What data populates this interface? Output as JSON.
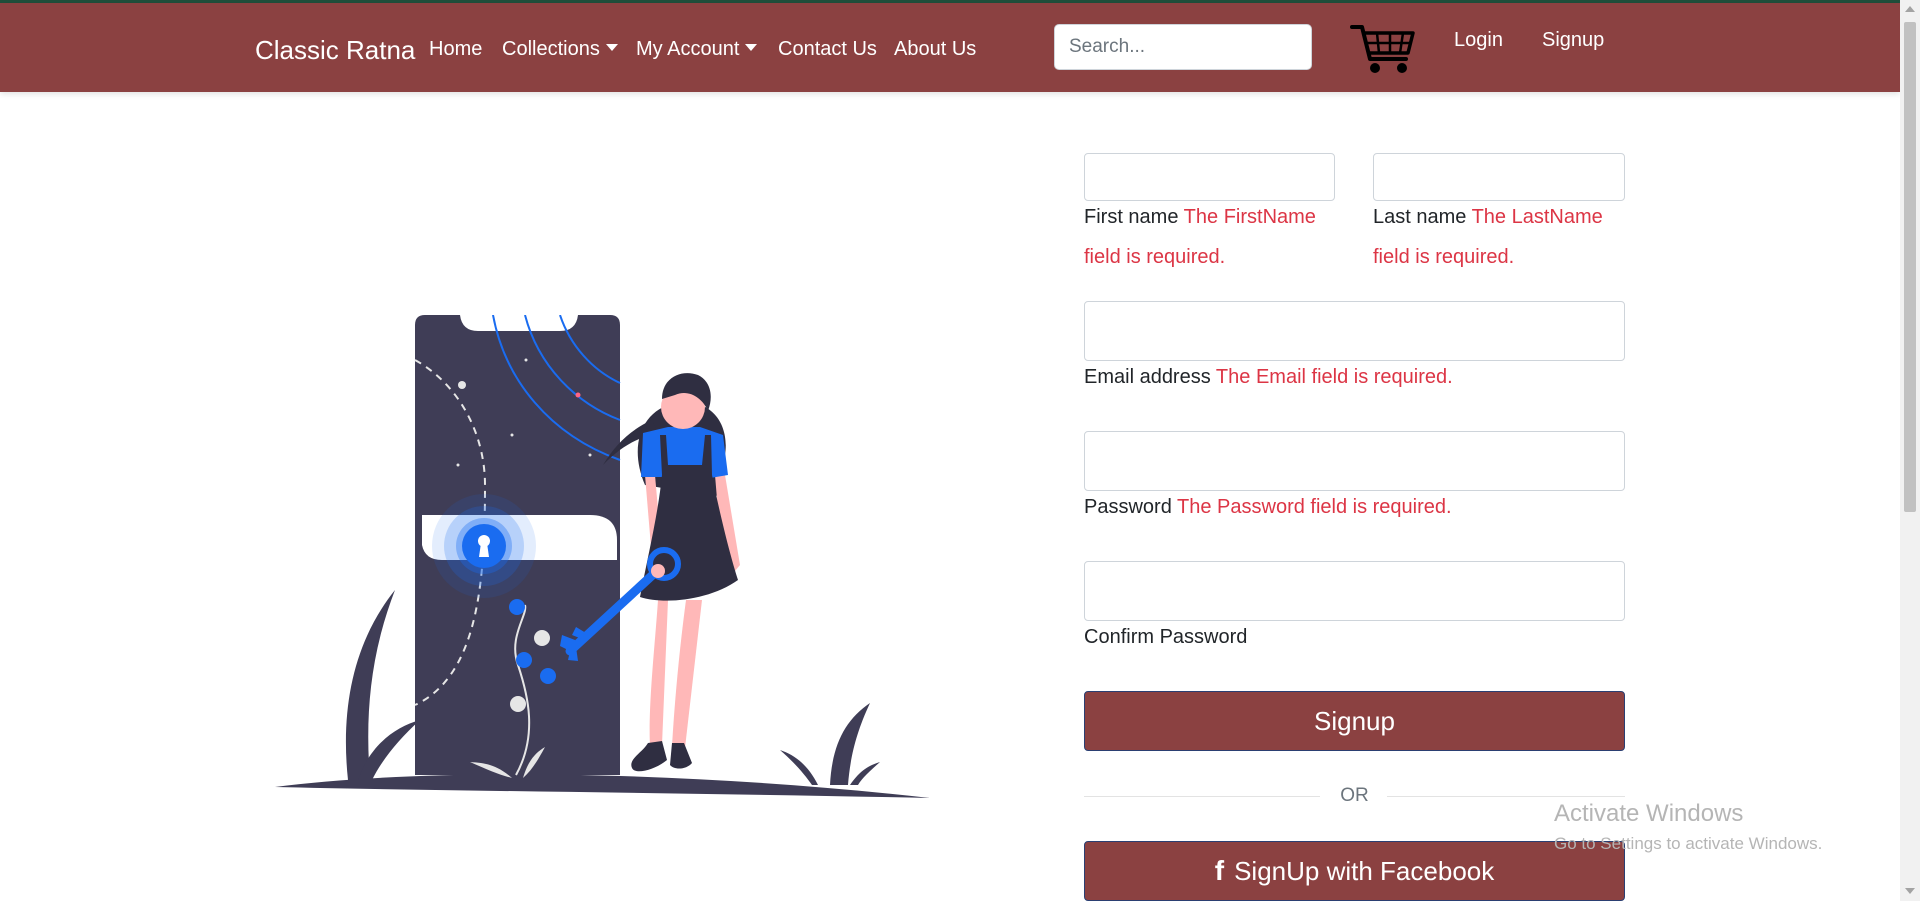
{
  "nav": {
    "brand": "Classic Ratna",
    "links": {
      "home": "Home",
      "collections": "Collections",
      "my_account": "My Account",
      "contact": "Contact Us",
      "about": "About Us"
    },
    "search_placeholder": "Search...",
    "cart_icon": "shopping-cart-icon",
    "login": "Login",
    "signup": "Signup"
  },
  "form": {
    "first_name": {
      "label": "First name",
      "error": "The FirstName field is required."
    },
    "last_name": {
      "label": "Last name",
      "error": "The LastName field is required."
    },
    "email": {
      "label": "Email address",
      "error": "The Email field is required."
    },
    "password": {
      "label": "Password",
      "error": "The Password field is required."
    },
    "confirm_password": {
      "label": "Confirm Password"
    },
    "signup_button": "Signup",
    "or_text": "OR",
    "facebook_icon": "f",
    "facebook_button": "SignUp with Facebook"
  },
  "watermark": {
    "title": "Activate Windows",
    "subtitle": "Go to Settings to activate Windows."
  },
  "colors": {
    "navbar": "#8b4141",
    "button": "#8b4141",
    "error": "#dc3545",
    "accent_blue": "#1a6cf0",
    "illustration_dark": "#3f3d56"
  }
}
